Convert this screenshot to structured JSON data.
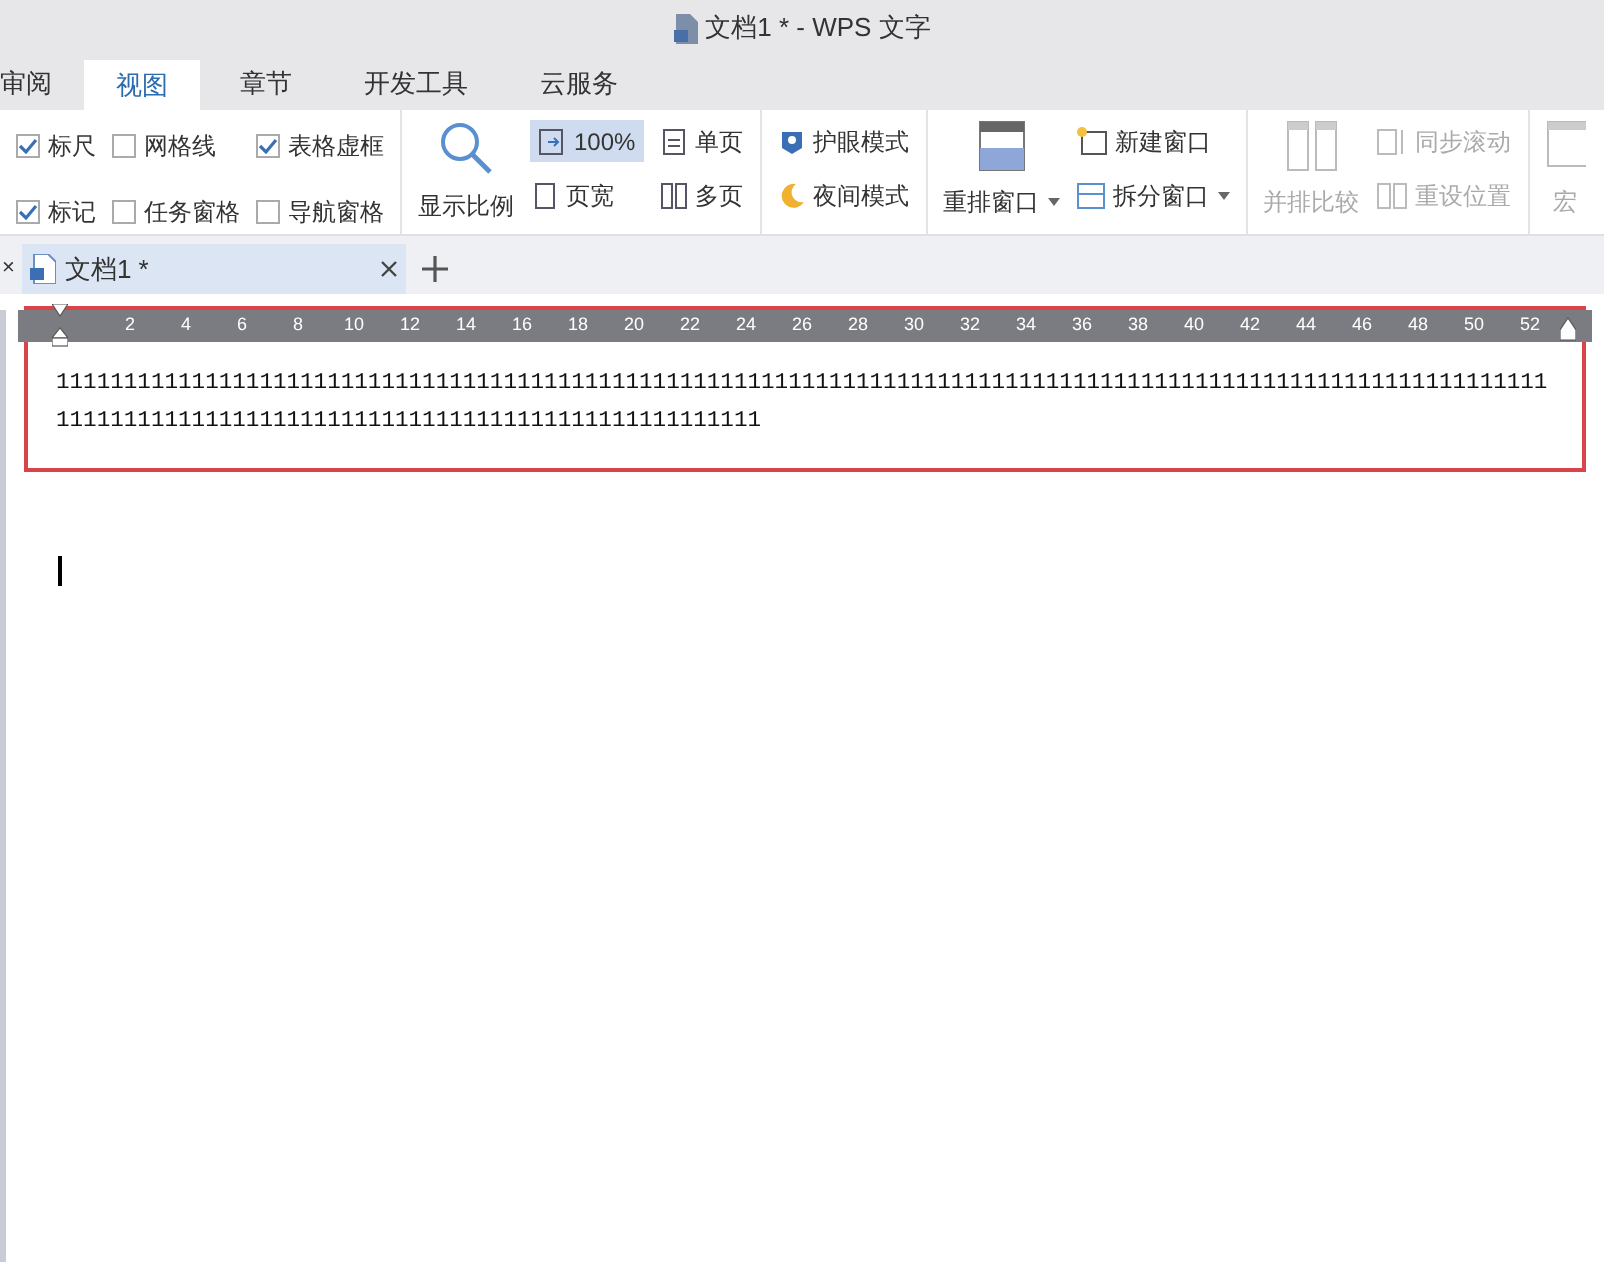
{
  "window": {
    "title": "文档1 * - WPS 文字"
  },
  "tabs": [
    {
      "label": "审阅",
      "selected": false
    },
    {
      "label": "视图",
      "selected": true
    },
    {
      "label": "章节",
      "selected": false
    },
    {
      "label": "开发工具",
      "selected": false
    },
    {
      "label": "云服务",
      "selected": false
    }
  ],
  "checkboxes": [
    {
      "label": "标尺",
      "checked": true
    },
    {
      "label": "网格线",
      "checked": false
    },
    {
      "label": "表格虚框",
      "checked": true
    },
    {
      "label": "标记",
      "checked": true
    },
    {
      "label": "任务窗格",
      "checked": false
    },
    {
      "label": "导航窗格",
      "checked": false
    }
  ],
  "zoom": {
    "label": "显示比例",
    "percent": "100%",
    "page_width": "页宽",
    "single_page": "单页",
    "multi_page": "多页"
  },
  "modes": [
    "护眼模式",
    "夜间模式"
  ],
  "windows": {
    "arrange": "重排窗口",
    "new_window": "新建窗口",
    "split": "拆分窗口"
  },
  "compare": [
    {
      "label": "并排比较",
      "disabled": true
    },
    {
      "label": "同步滚动",
      "disabled": true
    },
    {
      "label": "重设位置",
      "disabled": true
    }
  ],
  "macro": "宏",
  "doc_tabs_close": "×",
  "doc_tabs": [
    {
      "label": "文档1 *",
      "selected": true
    }
  ],
  "ruler": [
    "2",
    "4",
    "6",
    "8",
    "10",
    "12",
    "14",
    "16",
    "18",
    "20",
    "22",
    "24",
    "26",
    "28",
    "30",
    "32",
    "34",
    "36",
    "38",
    "40",
    "42",
    "44",
    "46",
    "48",
    "50",
    "52"
  ],
  "document": {
    "lines": [
      "11111111111111111111111111111111111111111111111111111111111111111111111111111111111111111111111111111111111111",
      "1111111111111111111111111111111111111111111111111111"
    ]
  }
}
